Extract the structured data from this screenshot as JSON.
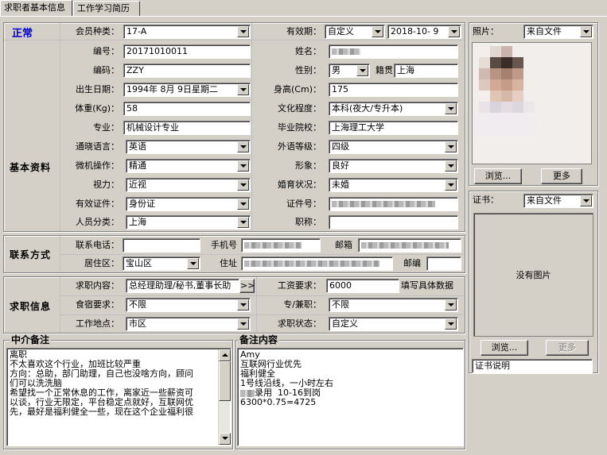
{
  "tabs": [
    "求职者基本信息",
    "工作学习简历"
  ],
  "status": "正常",
  "sections": {
    "basic": "基本资料",
    "contact": "联系方式",
    "job": "求职信息"
  },
  "fields": {
    "member_type": {
      "label": "会员种类：",
      "value": "17-A"
    },
    "validity": {
      "label": "有效期：",
      "mode": "自定义",
      "date": "2018-10- 9"
    },
    "number": {
      "label": "编号：",
      "value": "20171010011"
    },
    "name": {
      "label": "姓名："
    },
    "code": {
      "label": "编码：",
      "value": "ZZY"
    },
    "gender": {
      "label": "性别：",
      "value": "男"
    },
    "native": {
      "label": "籍贯",
      "value": "上海"
    },
    "birth": {
      "label": "出生日期：",
      "value": "1994年 8月 9日星期二"
    },
    "height": {
      "label": "身高(Cm)：",
      "value": "175"
    },
    "weight": {
      "label": "体重(Kg)：",
      "value": "58"
    },
    "education": {
      "label": "文化程度：",
      "value": "本科(夜大/专升本)"
    },
    "major": {
      "label": "专业：",
      "value": "机械设计专业"
    },
    "school": {
      "label": "毕业院校：",
      "value": "上海理工大学"
    },
    "language": {
      "label": "通晓语言：",
      "value": "英语"
    },
    "lang_level": {
      "label": "外语等级：",
      "value": "四级"
    },
    "computer": {
      "label": "微机操作：",
      "value": "精通"
    },
    "image": {
      "label": "形象：",
      "value": "良好"
    },
    "vision": {
      "label": "视力：",
      "value": "近视"
    },
    "marital": {
      "label": "婚育状况：",
      "value": "未婚"
    },
    "id_type": {
      "label": "有效证件：",
      "value": "身份证"
    },
    "id_no": {
      "label": "证件号："
    },
    "category": {
      "label": "人员分类：",
      "value": "上海"
    },
    "title": {
      "label": "职称：",
      "value": ""
    },
    "phone": {
      "label": "联系电话：",
      "value": ""
    },
    "mobile": {
      "label": "手机号"
    },
    "email": {
      "label": "邮箱"
    },
    "district": {
      "label": "居住区：",
      "value": "宝山区"
    },
    "address": {
      "label": "住址"
    },
    "postcode": {
      "label": "邮编",
      "value": ""
    },
    "job_content": {
      "label": "求职内容：",
      "value": "总经理助理/秘书,董事长助",
      "more": ">>"
    },
    "salary": {
      "label": "工资要求：",
      "value": "6000",
      "hint": "填写具体数据"
    },
    "board": {
      "label": "食宿要求：",
      "value": "不限"
    },
    "parttime": {
      "label": "专/兼职：",
      "value": "不限"
    },
    "location": {
      "label": "工作地点：",
      "value": "市区"
    },
    "job_status": {
      "label": "求职状态：",
      "value": "自定义"
    }
  },
  "photo": {
    "label": "照片：",
    "source": "来自文件",
    "browse": "浏览...",
    "more": "更多"
  },
  "cert": {
    "label": "证书：",
    "source": "来自文件",
    "empty": "没有图片",
    "browse": "浏览...",
    "more": "更多",
    "caption": "证书说明"
  },
  "agency_note": {
    "title": "中介备注",
    "lines": [
      "离职",
      "不太喜欢这个行业，加班比较严重",
      "",
      "方向：总助，部门助理，自己也没啥方向，顾问",
      "们可以洗洗脑",
      "",
      "希望找一个正常休息的工作，离家近一些薪资可",
      "以谈，行业无限定，平台稳定点就好，互联网优",
      "先，最好是福利健全一些，现在这个企业福利很"
    ]
  },
  "remark": {
    "title": "备注内容",
    "lines": [
      "Amy",
      "互联网行业优先",
      "",
      "福利健全",
      "",
      "1号线沿线，一小时左右",
      "",
      "录用  10-16到岗",
      "6300*0.75=4725"
    ]
  }
}
